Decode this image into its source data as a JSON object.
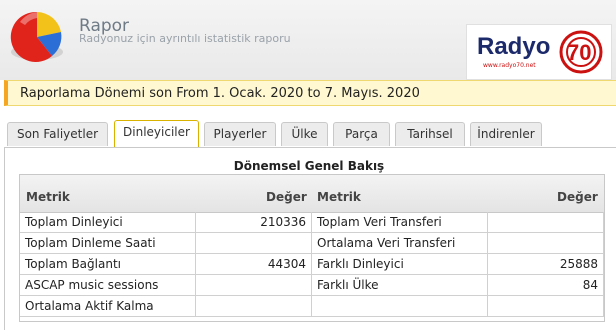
{
  "header": {
    "title": "Rapor",
    "subtitle": "Radyonuz için ayrıntılı istatistik raporu",
    "brand_name": "Radyo 70",
    "brand_url": "www.radyo70.net",
    "brand_color": "#1c2a6b",
    "accent_color": "#cc1111"
  },
  "period": {
    "text": "Raporlama Dönemi son From 1. Ocak. 2020 to 7. Mayıs. 2020"
  },
  "tabs": [
    {
      "label": "Son Faliyetler",
      "active": false
    },
    {
      "label": "Dinleyiciler",
      "active": true
    },
    {
      "label": "Playerler",
      "active": false
    },
    {
      "label": "Ülke",
      "active": false
    },
    {
      "label": "Parça",
      "active": false
    },
    {
      "label": "Tarihsel",
      "active": false
    },
    {
      "label": "İndirenler",
      "active": false
    }
  ],
  "overview": {
    "title": "Dönemsel Genel Bakış",
    "columns": [
      "Metrik",
      "Değer",
      "Metrik",
      "Değer"
    ],
    "rows": [
      {
        "m1": "Toplam Dinleyici",
        "v1": "210336",
        "m2": "Toplam Veri Transferi",
        "v2": ""
      },
      {
        "m1": "Toplam Dinleme Saati",
        "v1": "",
        "m2": "Ortalama Veri Transferi",
        "v2": ""
      },
      {
        "m1": "Toplam Bağlantı",
        "v1": "44304",
        "m2": "Farklı Dinleyici",
        "v2": "25888"
      },
      {
        "m1": "ASCAP music sessions",
        "v1": "",
        "m2": "Farklı Ülke",
        "v2": "84"
      },
      {
        "m1": "Ortalama Aktif Kalma",
        "v1": "",
        "m2": "",
        "v2": ""
      }
    ]
  }
}
